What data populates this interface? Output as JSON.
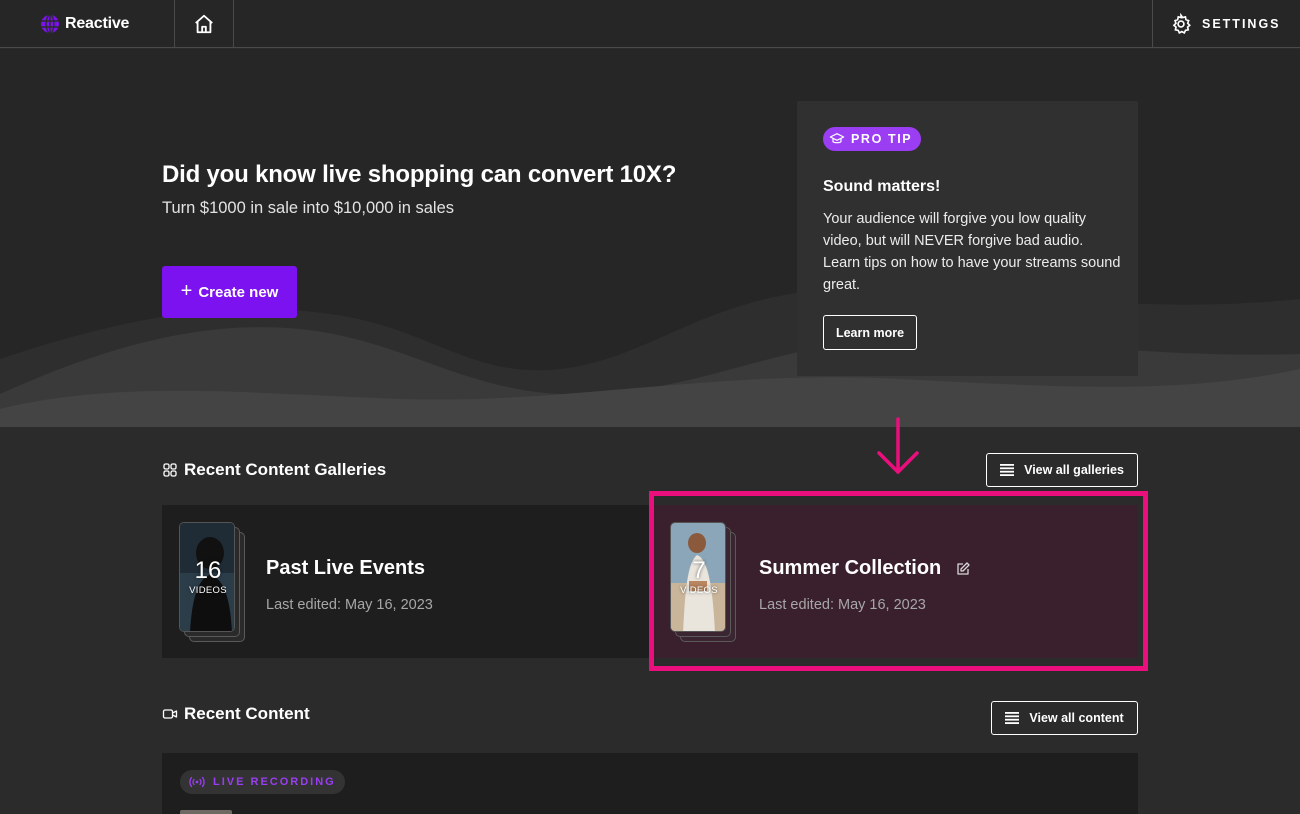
{
  "topbar": {
    "brand_name": "Reactive",
    "brand_icon": "globe-icon",
    "home_icon": "home-icon",
    "settings_label": "SETTINGS",
    "settings_icon": "gear-icon"
  },
  "hero": {
    "title": "Did you know live shopping can convert 10X?",
    "subtitle": "Turn $1000 in sale into $10,000 in sales",
    "create_label": "Create new"
  },
  "tip": {
    "badge": "PRO TIP",
    "title": "Sound matters!",
    "body": "Your audience will forgive you low quality video, but will NEVER forgive bad audio. Learn tips on how to have your streams sound great.",
    "learn_more": "Learn more"
  },
  "galleries": {
    "heading": "Recent Content Galleries",
    "view_all": "View all galleries",
    "items": [
      {
        "title": "Past Live Events",
        "count": "16",
        "count_label": "VIDEOS",
        "meta": "Last edited: May 16, 2023"
      },
      {
        "title": "Summer Collection",
        "count": "7",
        "count_label": "VIDEOS",
        "meta": "Last edited: May 16, 2023"
      }
    ]
  },
  "content": {
    "heading": "Recent Content",
    "view_all": "View all content",
    "items": [
      {
        "badge": "LIVE RECORDING"
      }
    ]
  },
  "colors": {
    "accent": "#7c12f0",
    "badge": "#9b3df2",
    "highlight": "#ea0f7d",
    "background": "#2b2b2b"
  }
}
